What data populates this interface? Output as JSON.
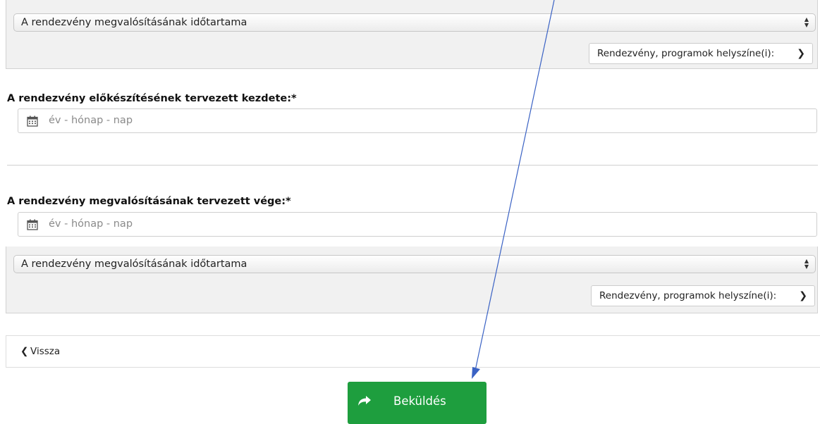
{
  "top_panel": {
    "select_value": "A rendezvény megvalósításának időtartama",
    "location_button": "Rendezvény, programok helyszíne(i):"
  },
  "start_field": {
    "label": "A rendezvény előkészítésének tervezett kezdete:*",
    "placeholder": "év - hónap - nap"
  },
  "end_field": {
    "label": "A rendezvény megvalósításának tervezett vége:*",
    "placeholder": "év - hónap - nap"
  },
  "bottom_panel": {
    "select_value": "A rendezvény megvalósításának időtartama",
    "location_button": "Rendezvény, programok helyszíne(i):"
  },
  "navigation": {
    "back_label": "Vissza"
  },
  "submit": {
    "label": "Beküldés",
    "color": "#1e9e3e"
  },
  "annotation": {
    "arrow_color": "#3a62c4"
  }
}
